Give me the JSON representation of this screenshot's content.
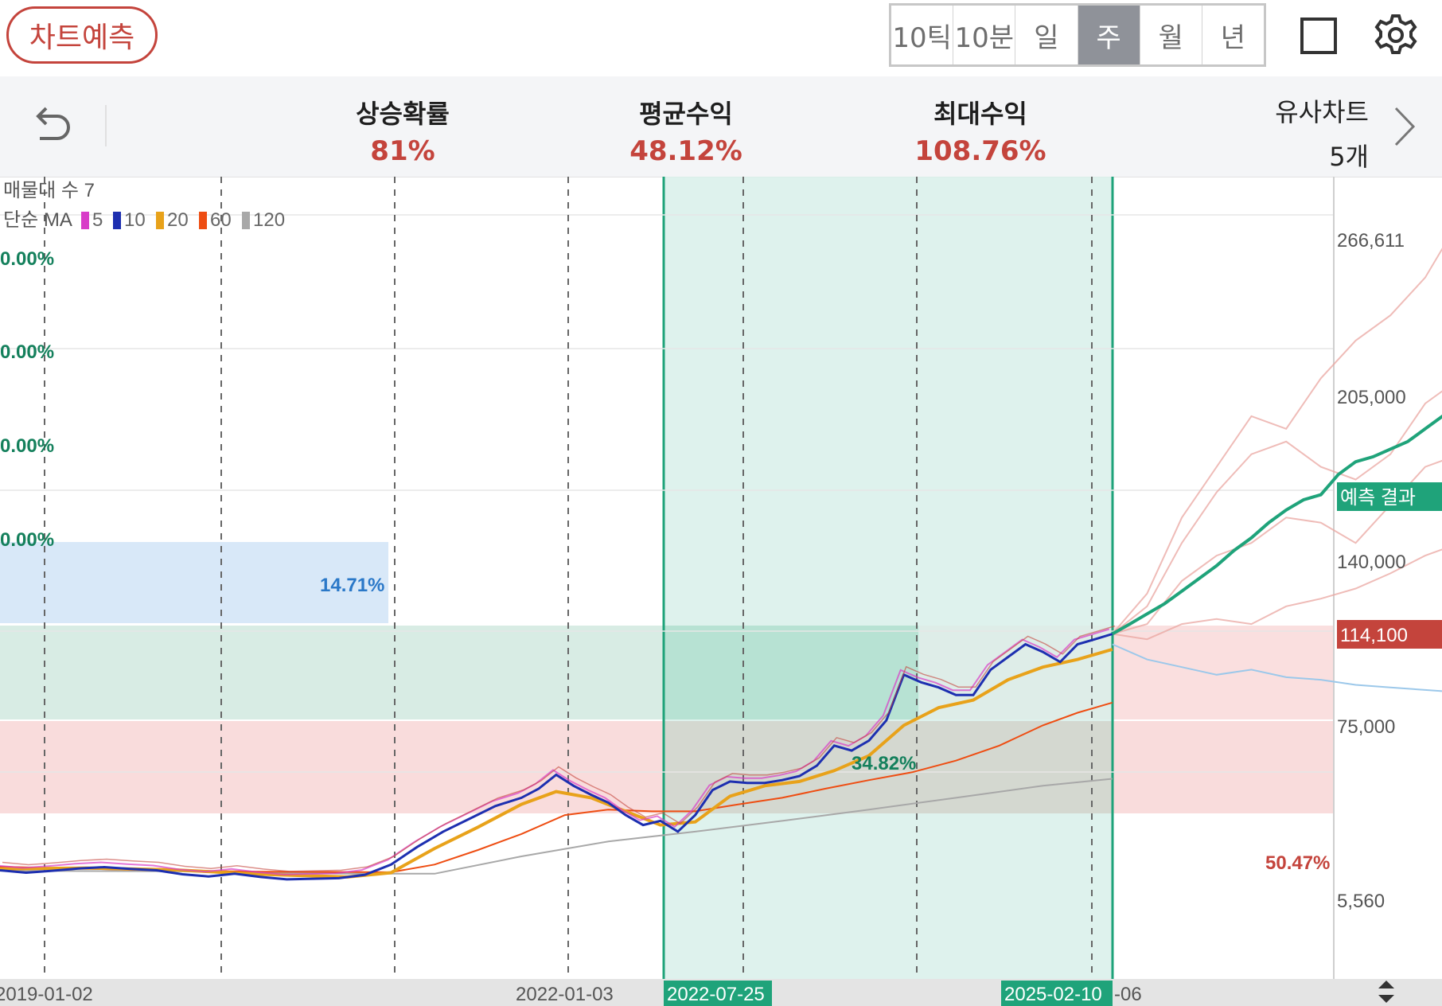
{
  "header": {
    "predict_button": "차트예측",
    "periods": [
      "10틱",
      "10분",
      "일",
      "주",
      "월",
      "년"
    ],
    "active_period": "주"
  },
  "stats": {
    "items": [
      {
        "label": "상승확률",
        "value": "81%"
      },
      {
        "label": "평균수익",
        "value": "48.12%"
      },
      {
        "label": "최대수익",
        "value": "108.76%"
      }
    ],
    "similar_label": "유사차트",
    "similar_count": "5개"
  },
  "colors": {
    "accent_red": "#c4443c",
    "prediction_green": "#1fa37a",
    "ma5": "#d83cc8",
    "ma10": "#1d2fb0",
    "ma20": "#e8a21a",
    "ma60": "#ee4d12",
    "ma120": "#a8a8a8"
  },
  "chart_data": {
    "type": "line",
    "title": "",
    "info": {
      "volume_profile": "매물대 수 7",
      "ma_label": "단순 MA",
      "ma_periods": [
        "5",
        "10",
        "20",
        "60",
        "120"
      ]
    },
    "y_ticks": [
      "266,611",
      "205,000",
      "140,000",
      "75,000",
      "5,560"
    ],
    "x_ticks": [
      "2019-01-02",
      "2022-01-03"
    ],
    "selection_start": "2022-07-25",
    "selection_end": "2025-02-10",
    "x_end_label_fragment": "-06",
    "current_price": "114,100",
    "prediction_label": "예측 결과",
    "left_percent_labels": [
      "0.00%",
      "0.00%",
      "0.00%",
      "0.00%"
    ],
    "zones": [
      {
        "label": "14.71%",
        "color": "blue"
      },
      {
        "label": "34.82%",
        "color": "green"
      },
      {
        "label": "50.47%",
        "color": "red"
      }
    ],
    "price_series": [
      [
        0,
        9500
      ],
      [
        30,
        9000
      ],
      [
        60,
        9400
      ],
      [
        90,
        9900
      ],
      [
        120,
        10200
      ],
      [
        150,
        9800
      ],
      [
        180,
        9500
      ],
      [
        210,
        8700
      ],
      [
        240,
        8300
      ],
      [
        270,
        8800
      ],
      [
        300,
        8200
      ],
      [
        330,
        7800
      ],
      [
        360,
        7900
      ],
      [
        390,
        8000
      ],
      [
        420,
        8600
      ],
      [
        450,
        10800
      ],
      [
        480,
        16000
      ],
      [
        510,
        22000
      ],
      [
        540,
        28000
      ],
      [
        570,
        35000
      ],
      [
        600,
        40000
      ],
      [
        620,
        46000
      ],
      [
        640,
        56000
      ],
      [
        660,
        48000
      ],
      [
        680,
        42000
      ],
      [
        700,
        37000
      ],
      [
        720,
        30000
      ],
      [
        740,
        25000
      ],
      [
        760,
        27000
      ],
      [
        780,
        22000
      ],
      [
        800,
        30000
      ],
      [
        820,
        45000
      ],
      [
        840,
        51000
      ],
      [
        860,
        50000
      ],
      [
        880,
        50000
      ],
      [
        900,
        52000
      ],
      [
        920,
        55000
      ],
      [
        940,
        62000
      ],
      [
        960,
        70000
      ],
      [
        980,
        68000
      ],
      [
        1000,
        72000
      ],
      [
        1020,
        80000
      ],
      [
        1040,
        98000
      ],
      [
        1060,
        95000
      ],
      [
        1080,
        93000
      ],
      [
        1100,
        90000
      ],
      [
        1120,
        90000
      ],
      [
        1140,
        100000
      ],
      [
        1160,
        105000
      ],
      [
        1180,
        110000
      ],
      [
        1200,
        107000
      ],
      [
        1220,
        103000
      ],
      [
        1240,
        110000
      ],
      [
        1260,
        112000
      ],
      [
        1280,
        114100
      ]
    ],
    "ma20": [
      [
        0,
        9800
      ],
      [
        100,
        10000
      ],
      [
        200,
        9600
      ],
      [
        300,
        8700
      ],
      [
        400,
        8200
      ],
      [
        450,
        9000
      ],
      [
        500,
        15500
      ],
      [
        550,
        24000
      ],
      [
        600,
        36000
      ],
      [
        640,
        44000
      ],
      [
        680,
        40000
      ],
      [
        720,
        32000
      ],
      [
        760,
        25000
      ],
      [
        800,
        26500
      ],
      [
        840,
        41000
      ],
      [
        880,
        48000
      ],
      [
        920,
        51000
      ],
      [
        960,
        60000
      ],
      [
        1000,
        66000
      ],
      [
        1040,
        78000
      ],
      [
        1080,
        85000
      ],
      [
        1120,
        88000
      ],
      [
        1160,
        96000
      ],
      [
        1200,
        101000
      ],
      [
        1240,
        104000
      ],
      [
        1280,
        108000
      ]
    ],
    "ma60": [
      [
        0,
        10300
      ],
      [
        150,
        9600
      ],
      [
        300,
        9200
      ],
      [
        450,
        9100
      ],
      [
        500,
        10800
      ],
      [
        550,
        15000
      ],
      [
        600,
        21000
      ],
      [
        650,
        30000
      ],
      [
        700,
        33000
      ],
      [
        750,
        32000
      ],
      [
        800,
        32000
      ],
      [
        850,
        36000
      ],
      [
        900,
        40000
      ],
      [
        950,
        46000
      ],
      [
        1000,
        52000
      ],
      [
        1050,
        58000
      ],
      [
        1100,
        64000
      ],
      [
        1150,
        70000
      ],
      [
        1200,
        78000
      ],
      [
        1240,
        83000
      ],
      [
        1280,
        87000
      ]
    ],
    "ma120": [
      [
        0,
        9400
      ],
      [
        200,
        9300
      ],
      [
        400,
        8800
      ],
      [
        500,
        8800
      ],
      [
        600,
        13000
      ],
      [
        700,
        18000
      ],
      [
        800,
        22000
      ],
      [
        900,
        27000
      ],
      [
        1000,
        33000
      ],
      [
        1100,
        40000
      ],
      [
        1200,
        48000
      ],
      [
        1280,
        53000
      ]
    ],
    "prediction": [
      [
        1280,
        114100
      ],
      [
        1300,
        118000
      ],
      [
        1320,
        122000
      ],
      [
        1340,
        126000
      ],
      [
        1360,
        131000
      ],
      [
        1380,
        136000
      ],
      [
        1400,
        141000
      ],
      [
        1420,
        147000
      ],
      [
        1440,
        152000
      ],
      [
        1460,
        158000
      ],
      [
        1480,
        163000
      ],
      [
        1500,
        167000
      ],
      [
        1520,
        169000
      ],
      [
        1540,
        177000
      ],
      [
        1560,
        182000
      ],
      [
        1580,
        184000
      ],
      [
        1600,
        187000
      ],
      [
        1620,
        190000
      ],
      [
        1640,
        195000
      ],
      [
        1660,
        200000
      ],
      [
        1680,
        205000
      ]
    ],
    "similar_paths": [
      [
        [
          1280,
          114100
        ],
        [
          1320,
          130000
        ],
        [
          1360,
          160000
        ],
        [
          1400,
          180000
        ],
        [
          1440,
          200000
        ],
        [
          1480,
          195000
        ],
        [
          1520,
          215000
        ],
        [
          1560,
          230000
        ],
        [
          1600,
          240000
        ],
        [
          1640,
          255000
        ],
        [
          1660,
          266611
        ],
        [
          1680,
          250000
        ]
      ],
      [
        [
          1280,
          114100
        ],
        [
          1320,
          125000
        ],
        [
          1360,
          150000
        ],
        [
          1400,
          170000
        ],
        [
          1440,
          185000
        ],
        [
          1480,
          190000
        ],
        [
          1520,
          180000
        ],
        [
          1560,
          175000
        ],
        [
          1600,
          185000
        ],
        [
          1640,
          205000
        ],
        [
          1680,
          215000
        ]
      ],
      [
        [
          1280,
          114100
        ],
        [
          1320,
          118000
        ],
        [
          1360,
          135000
        ],
        [
          1400,
          145000
        ],
        [
          1440,
          150000
        ],
        [
          1480,
          160000
        ],
        [
          1520,
          158000
        ],
        [
          1560,
          150000
        ],
        [
          1600,
          165000
        ],
        [
          1640,
          180000
        ],
        [
          1680,
          185000
        ]
      ],
      [
        [
          1280,
          114100
        ],
        [
          1320,
          112000
        ],
        [
          1360,
          118000
        ],
        [
          1400,
          120000
        ],
        [
          1440,
          118000
        ],
        [
          1480,
          125000
        ],
        [
          1520,
          128000
        ],
        [
          1560,
          132000
        ],
        [
          1600,
          138000
        ],
        [
          1640,
          145000
        ],
        [
          1680,
          150000
        ]
      ]
    ],
    "low_path": [
      [
        1280,
        110000
      ],
      [
        1320,
        104000
      ],
      [
        1360,
        101000
      ],
      [
        1400,
        98000
      ],
      [
        1440,
        100000
      ],
      [
        1480,
        97000
      ],
      [
        1520,
        96000
      ],
      [
        1560,
        94000
      ],
      [
        1600,
        93000
      ],
      [
        1640,
        92000
      ],
      [
        1680,
        91000
      ]
    ]
  }
}
